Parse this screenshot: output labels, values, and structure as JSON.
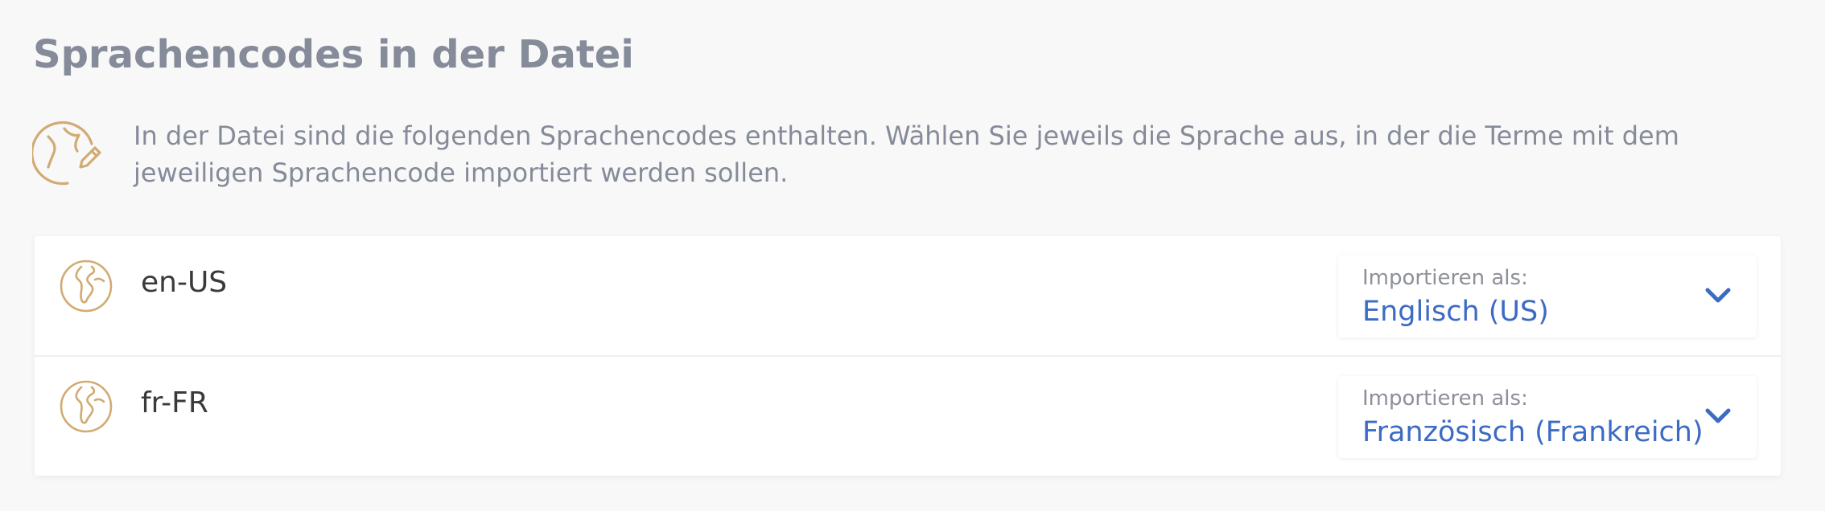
{
  "page": {
    "title": "Sprachencodes in der Datei",
    "intro": "In der Datei sind die folgenden Sprachencodes enthalten. Wählen Sie jeweils die Sprache aus, in der die Terme mit dem jeweiligen Sprachencode importiert werden sollen."
  },
  "icons": {
    "intro": "globe-pencil-icon",
    "row": "globe-icon",
    "dropdown": "chevron-down-icon"
  },
  "colors": {
    "accent_icon": "#d1ab72",
    "selected_value": "#3c6bc4",
    "muted_text": "#858b98"
  },
  "languages": [
    {
      "code": "en-US",
      "select_label": "Importieren als:",
      "selected": "Englisch (US)"
    },
    {
      "code": "fr-FR",
      "select_label": "Importieren als:",
      "selected": "Französisch (Frankreich)"
    }
  ]
}
